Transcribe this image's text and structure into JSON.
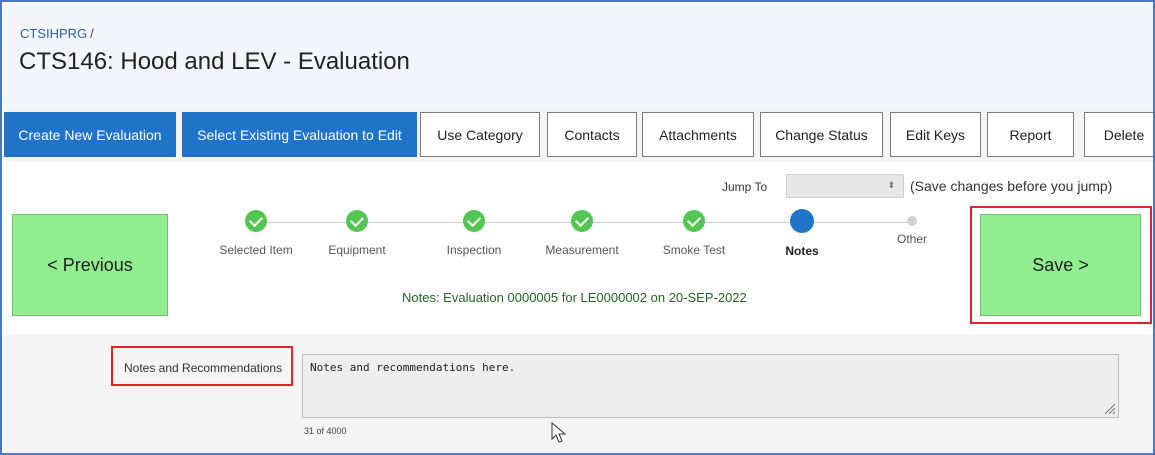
{
  "header": {
    "breadcrumb": "CTSIHPRG",
    "breadcrumb_sep": "/",
    "title": "CTS146: Hood and LEV - Evaluation"
  },
  "toolbar": {
    "buttons": [
      {
        "label": "Create New Evaluation"
      },
      {
        "label": "Select Existing Evaluation to Edit"
      },
      {
        "label": "Use Category"
      },
      {
        "label": "Contacts"
      },
      {
        "label": "Attachments"
      },
      {
        "label": "Change Status"
      },
      {
        "label": "Edit Keys"
      },
      {
        "label": "Report"
      },
      {
        "label": "Delete"
      }
    ]
  },
  "jump": {
    "label": "Jump To",
    "selected_value": "",
    "hint": "(Save changes before you jump)"
  },
  "nav": {
    "previous_label": "< Previous",
    "save_label": "Save >"
  },
  "steps": [
    {
      "label": "Selected Item",
      "state": "done"
    },
    {
      "label": "Equipment",
      "state": "done"
    },
    {
      "label": "Inspection",
      "state": "done"
    },
    {
      "label": "Measurement",
      "state": "done"
    },
    {
      "label": "Smoke Test",
      "state": "done"
    },
    {
      "label": "Notes",
      "state": "current"
    },
    {
      "label": "Other",
      "state": "todo"
    }
  ],
  "status_line": "Notes: Evaluation 0000005 for LE0000002 on 20-SEP-2022",
  "form": {
    "notes_label": "Notes and Recommendations",
    "notes_value": "Notes and recommendations here.",
    "char_count": "31 of 4000"
  },
  "colors": {
    "primary": "#1f73c9",
    "save_green": "#90ee90",
    "done_green": "#52c552",
    "highlight_red": "#d9262b"
  },
  "icons": {
    "step_done": "check-circle-icon",
    "step_current": "current-step-dot-icon",
    "step_todo": "pending-step-dot-icon",
    "select_arrows": "updown-arrows-icon",
    "resize": "resize-grip-icon",
    "cursor": "mouse-pointer-icon"
  }
}
